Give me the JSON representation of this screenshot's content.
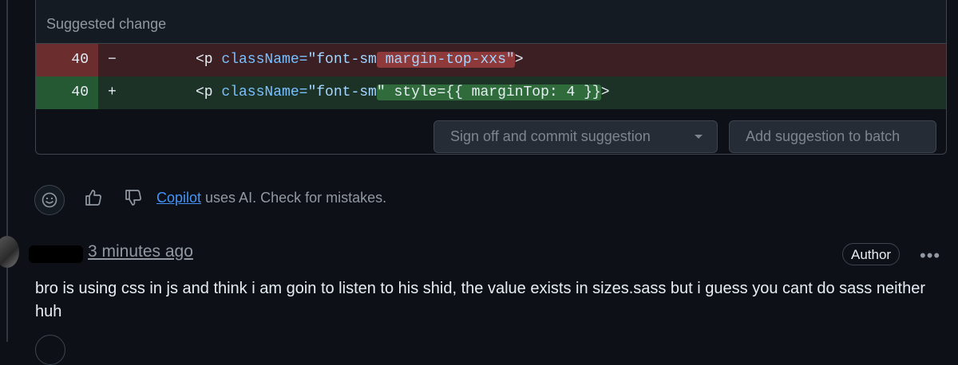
{
  "suggestion": {
    "title": "Suggested change",
    "deleted_line": {
      "number": "40",
      "marker": "−",
      "indent": "        ",
      "code_tag": "<p ",
      "code_attr": "className=",
      "code_value": "\"font-sm",
      "code_highlight": " margin-top-xxs\"",
      "code_end": ">"
    },
    "added_line": {
      "number": "40",
      "marker": "+",
      "indent": "        ",
      "code_tag": "<p ",
      "code_attr": "className=",
      "code_value": "\"font-sm",
      "code_highlight": "\" style={{ marginTop: 4 }}",
      "code_end": ">"
    },
    "commit_button": "Sign off and commit suggestion",
    "batch_button": "Add suggestion to batch"
  },
  "footer": {
    "copilot_link": "Copilot",
    "copilot_text": " uses AI. Check for mistakes."
  },
  "comment": {
    "timestamp": "3 minutes ago",
    "badge": "Author",
    "more": "•••",
    "body": "bro is using css in js and think i am goin to listen to his shid, the value exists in sizes.sass but i guess you cant do sass neither huh"
  },
  "icons": [
    "smiley-icon",
    "thumbs-up-icon",
    "thumbs-down-icon",
    "chevron-down-icon",
    "kebab-icon"
  ],
  "colors": {
    "background": "#0d1117",
    "deleted_row": "#3b1f22",
    "added_row": "#1c3226",
    "link": "#4493f8"
  }
}
